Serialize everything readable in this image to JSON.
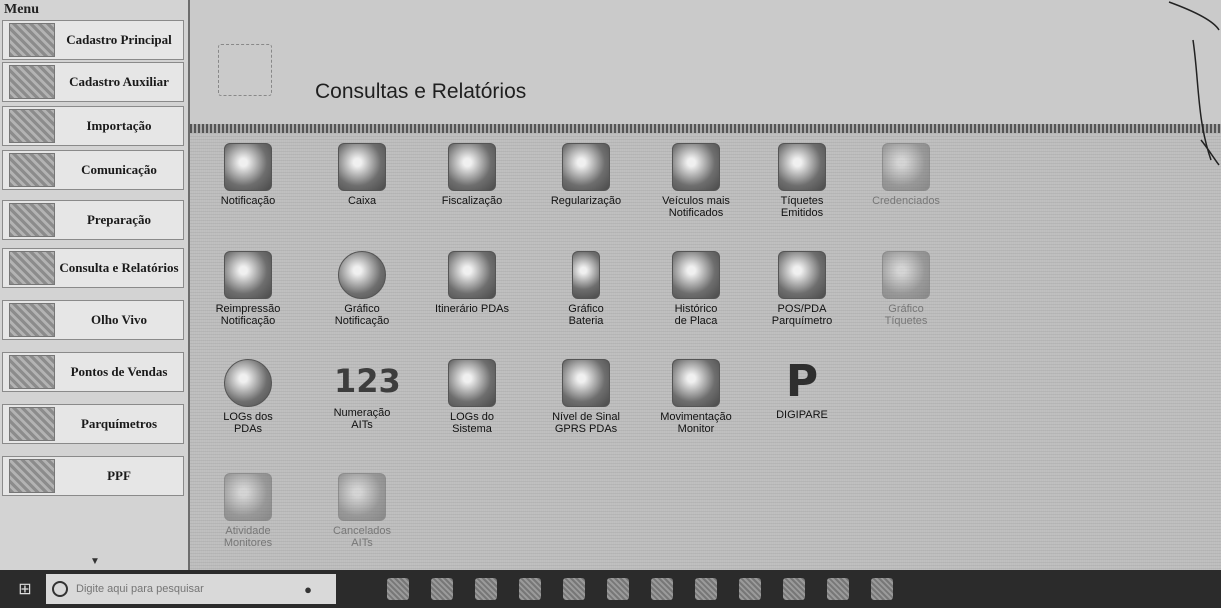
{
  "sidebar": {
    "title": "Menu",
    "items": [
      {
        "label": "Cadastro Principal",
        "icon": "ruler-icon"
      },
      {
        "label": "Cadastro Auxiliar",
        "icon": "map-icon"
      },
      {
        "label": "Importação",
        "icon": "import-icon"
      },
      {
        "label": "Comunicação",
        "icon": "globe-icon"
      },
      {
        "label": "Preparação",
        "icon": "tools-icon"
      },
      {
        "label": "Consulta e Relatórios",
        "icon": "report-icon"
      },
      {
        "label": "Olho Vivo",
        "icon": "eye-icon"
      },
      {
        "label": "Pontos de Vendas",
        "icon": "store-icon"
      },
      {
        "label": "Parquímetros",
        "icon": "parking-meter-icon"
      },
      {
        "label": "PPF",
        "icon": "ppf-icon"
      }
    ]
  },
  "header": {
    "title": "Consultas e Relatórios"
  },
  "tiles": [
    {
      "label": "Notificação",
      "icon": "notification-icon",
      "faded": false
    },
    {
      "label": "Caixa",
      "icon": "cash-icon",
      "faded": false
    },
    {
      "label": "Fiscalização",
      "icon": "inspection-icon",
      "faded": false
    },
    {
      "label": "Regularização",
      "icon": "agent-icon",
      "faded": false
    },
    {
      "label": "Veículos mais\nNotificados",
      "icon": "car-icon",
      "faded": false
    },
    {
      "label": "Tíquetes\nEmitidos",
      "icon": "ticket-car-icon",
      "faded": false
    },
    {
      "label": "Credenciados",
      "icon": "checklist-icon",
      "faded": true
    },
    {
      "label": "Reimpressão\nNotificação",
      "icon": "printer-icon",
      "faded": false
    },
    {
      "label": "Gráfico\nNotificação",
      "icon": "pie-chart-icon",
      "faded": false
    },
    {
      "label": "Itinerário PDAs",
      "icon": "map-route-icon",
      "faded": false
    },
    {
      "label": "Gráfico\nBateria",
      "icon": "battery-icon",
      "faded": false
    },
    {
      "label": "Histórico\nde Placa",
      "icon": "history-icon",
      "faded": false
    },
    {
      "label": "POS/PDA\nParquímetro",
      "icon": "pos-icon",
      "faded": false
    },
    {
      "label": "Gráfico\nTíquetes",
      "icon": "bar-chart-icon",
      "faded": true
    },
    {
      "label": "LOGs dos\nPDAs",
      "icon": "pda-log-icon",
      "faded": false
    },
    {
      "label": "Numeração\nAITs",
      "icon": "numbering-icon",
      "faded": false
    },
    {
      "label": "LOGs do\nSistema",
      "icon": "system-log-icon",
      "faded": false
    },
    {
      "label": "Nível de Sinal\nGPRS PDAs",
      "icon": "signal-icon",
      "faded": false
    },
    {
      "label": "Movimentação\nMonitor",
      "icon": "money-stack-icon",
      "faded": false
    },
    {
      "label": "DIGIPARE",
      "icon": "digipare-icon",
      "faded": false
    },
    {
      "label": "Atividade\nMonitores",
      "icon": "activity-icon",
      "faded": true
    },
    {
      "label": "Cancelados\nAITs",
      "icon": "cancel-icon",
      "faded": true
    }
  ],
  "taskbar": {
    "search_placeholder": "Digite aqui para pesquisar"
  }
}
